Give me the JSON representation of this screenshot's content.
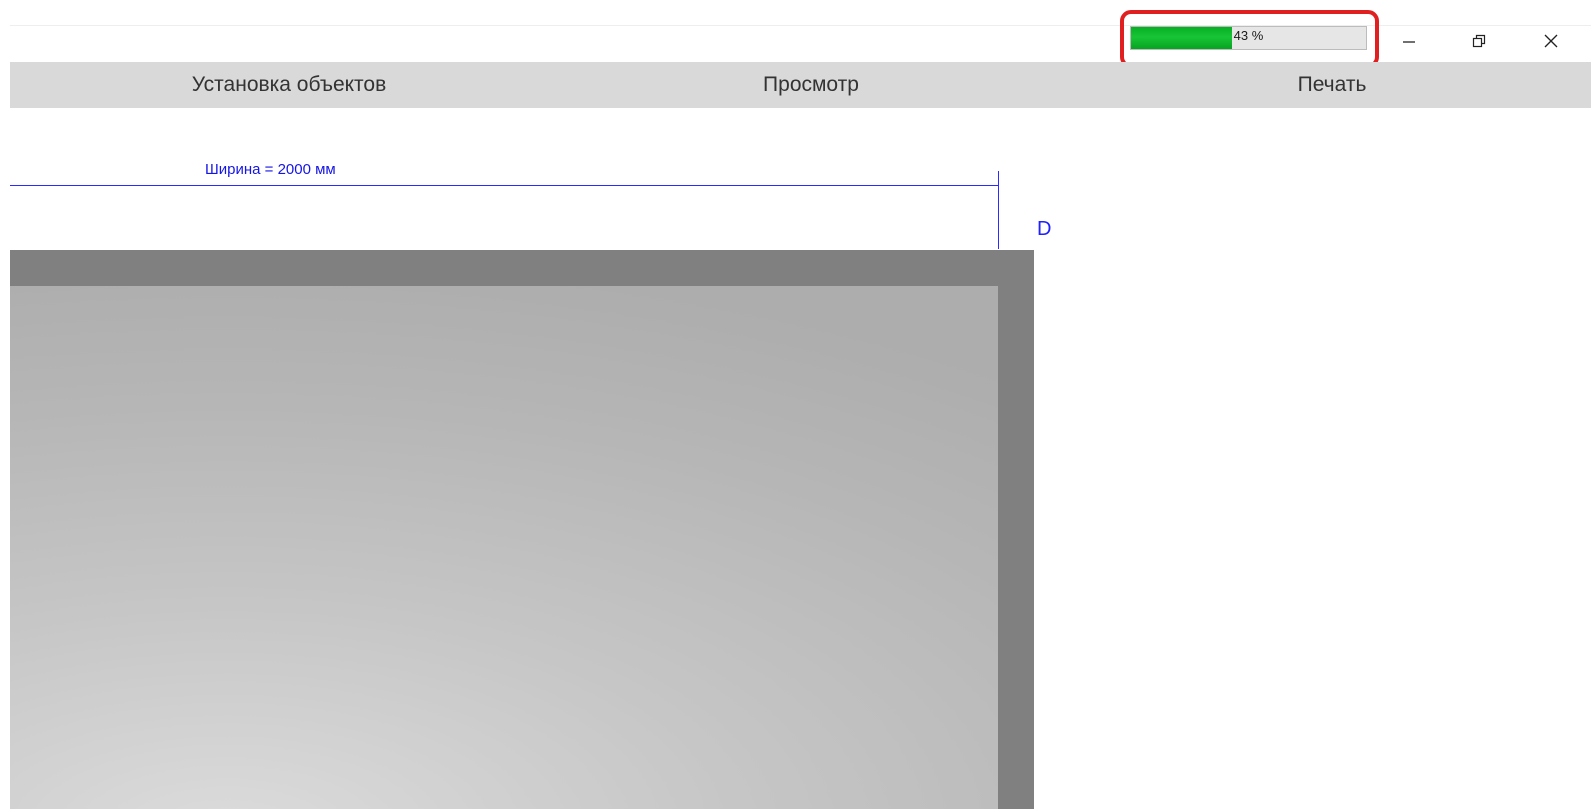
{
  "window": {
    "progress": {
      "value": 0.43,
      "label": "43 %",
      "fill_color": "#06b025"
    },
    "highlight_color": "#e02020",
    "controls": {
      "minimize_icon": "minimize-icon",
      "restore_icon": "restore-icon",
      "close_icon": "close-icon"
    }
  },
  "menu": {
    "items": [
      {
        "label": "Установка объектов"
      },
      {
        "label": "Просмотр"
      },
      {
        "label": "Печать"
      }
    ]
  },
  "canvas": {
    "width_label": "Ширина = 2000 мм",
    "side_label": "D",
    "dimension_color": "#2020ff",
    "frame_color": "#808080"
  }
}
